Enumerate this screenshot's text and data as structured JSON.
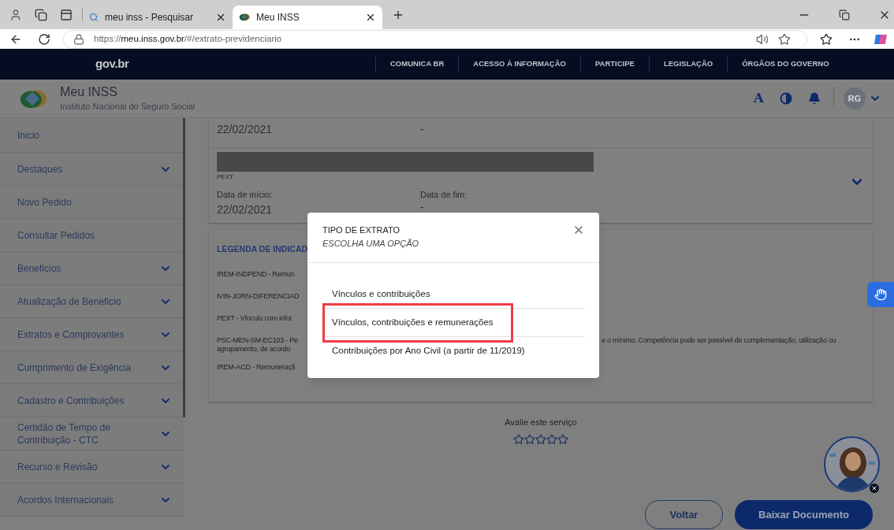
{
  "browser": {
    "tabs": [
      {
        "title": "meu inss - Pesquisar",
        "kind": "search",
        "selected": false
      },
      {
        "title": "Meu INSS",
        "kind": "site",
        "selected": true
      }
    ],
    "url": "https://**meu.inss.gov.br**/#/extrato-previdenciario"
  },
  "gov_bar": {
    "logo": "gov.br",
    "links": [
      "COMUNICA BR",
      "ACESSO À INFORMAÇÃO",
      "PARTICIPE",
      "LEGISLAÇÃO",
      "ÓRGÃOS DO GOVERNO"
    ]
  },
  "header": {
    "title": "Meu INSS",
    "subtitle": "Instituto Nacional do Seguro Social",
    "font_button": "A",
    "avatar": "RG"
  },
  "sidebar": {
    "items": [
      {
        "label": "Inicio",
        "expandable": false
      },
      {
        "label": "Destaques",
        "expandable": true
      },
      {
        "label": "Novo Pedido",
        "expandable": false
      },
      {
        "label": "Consultar Pedidos",
        "expandable": false
      },
      {
        "label": "Beneficios",
        "expandable": true
      },
      {
        "label": "Atualização de Beneficio",
        "expandable": true
      },
      {
        "label": "Extratos e Comprovantes",
        "expandable": true
      },
      {
        "label": "Cumprimento de Exigência",
        "expandable": true
      },
      {
        "label": "Cadastro e Contribuições",
        "expandable": true
      },
      {
        "label": "Certidão de Tempo de Contribuição - CTC",
        "expandable": true
      },
      {
        "label": "Recurso e Revisão",
        "expandable": true
      },
      {
        "label": "Acordos Internacionais",
        "expandable": true
      }
    ]
  },
  "top_record": {
    "start_date": "22/02/2021",
    "end_date": "-"
  },
  "record": {
    "code": "PEXT",
    "start_label": "Data de início:",
    "start_date": "22/02/2021",
    "end_label": "Data de fim:",
    "end_date": "-",
    "expanded": false
  },
  "legend": {
    "title": "LEGENDA DE INDICAD",
    "items": [
      {
        "text": "IREM-INDPEND - Remun"
      },
      {
        "text": "IVIN-JORN-DIFERENCIAD"
      },
      {
        "text": "PEXT - Vínculo com infor"
      },
      {
        "text": "PSC-MEN-SM-EC103 - Pe",
        "continuation": "e o mínimo. Competência pode ser passível de complementação, utilização ou",
        "second_line": "agrupamento, de acordo"
      },
      {
        "text": "IREM-ACD - Remuneraçã"
      }
    ]
  },
  "rating": {
    "prompt": "Avalie este serviço",
    "stars": 0
  },
  "buttons": [
    {
      "label": "Voltar",
      "kind": "outline"
    },
    {
      "label": "Baixar Documento",
      "kind": "primary"
    }
  ],
  "modal": {
    "title": "TIPO DE EXTRATO",
    "subtitle": "ESCOLHA UMA OPÇÃO",
    "options": [
      {
        "label": "Vínculos e contribuições",
        "highlighted": false
      },
      {
        "label": "Vínculos, contribuições e remunerações",
        "highlighted": true
      },
      {
        "label": "Contribuições por Ano Civil (a partir de 11/2019)",
        "highlighted": false
      }
    ]
  }
}
